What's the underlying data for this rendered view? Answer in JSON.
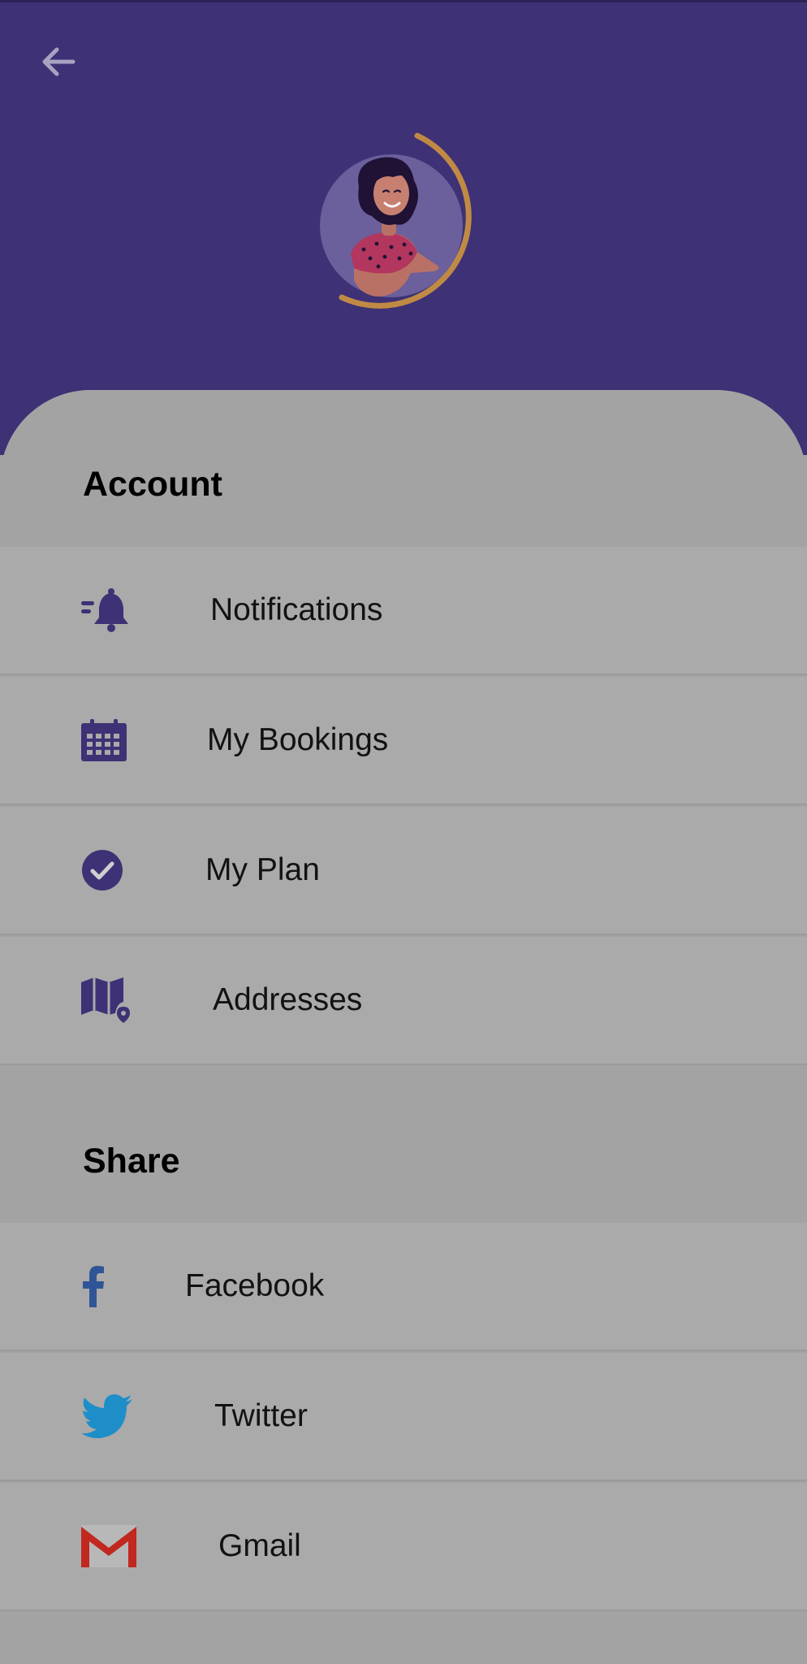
{
  "header": {
    "back_icon": "arrow-left-icon",
    "avatar_icon": "woman-avatar-illustration",
    "colors": {
      "background": "#3e3175",
      "ring": "#c08a45",
      "avatar_bg": "#6b5f9c"
    }
  },
  "account": {
    "title": "Account",
    "items": [
      {
        "label": "Notifications",
        "icon": "bell-icon"
      },
      {
        "label": "My Bookings",
        "icon": "calendar-icon"
      },
      {
        "label": "My Plan",
        "icon": "check-circle-icon"
      },
      {
        "label": "Addresses",
        "icon": "map-pin-icon"
      }
    ]
  },
  "share": {
    "title": "Share",
    "items": [
      {
        "label": "Facebook",
        "icon": "facebook-icon"
      },
      {
        "label": "Twitter",
        "icon": "twitter-icon"
      },
      {
        "label": "Gmail",
        "icon": "gmail-icon"
      }
    ]
  },
  "colors": {
    "accent": "#3e3175",
    "facebook": "#2f5597",
    "twitter": "#1e8ec9",
    "gmail": "#c1281f"
  }
}
